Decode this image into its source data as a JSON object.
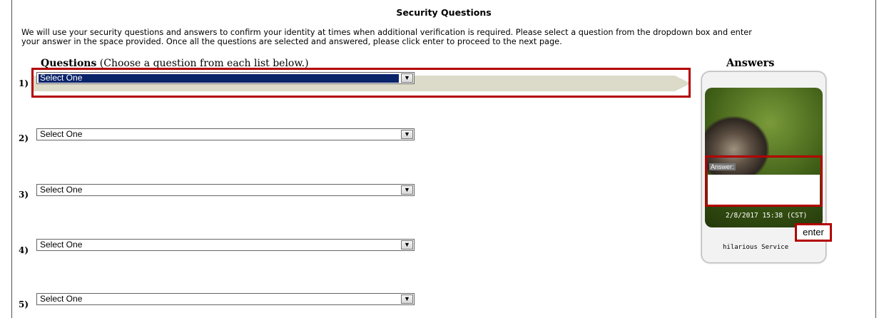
{
  "page": {
    "title": "Security Questions",
    "intro_line1": "We will use your security questions and answers to confirm your identity at times when additional verification is required. Please select a question from the dropdown box and enter",
    "intro_line2": "your answer in the space provided. Once all the questions are selected and answered, please click enter to proceed to the next page."
  },
  "questions_header": {
    "bold": "Questions",
    "hint": " (Choose a question from each list below.)"
  },
  "answers_header": "Answers",
  "questions": [
    {
      "number": "1)",
      "value": "Select One",
      "active": true
    },
    {
      "number": "2)",
      "value": "Select One"
    },
    {
      "number": "3)",
      "value": "Select One"
    },
    {
      "number": "4)",
      "value": "Select One"
    },
    {
      "number": "5)",
      "value": "Select One"
    }
  ],
  "answer_widget": {
    "answer_label": "Answer:",
    "answer_value": "",
    "timestamp": "2/8/2017 15:38 (CST)",
    "enter_label": "enter",
    "service_label": "hilarious Service"
  },
  "colors": {
    "highlight": "#b30000",
    "selection": "#0a246a",
    "arrow": "#dcdbc9"
  }
}
